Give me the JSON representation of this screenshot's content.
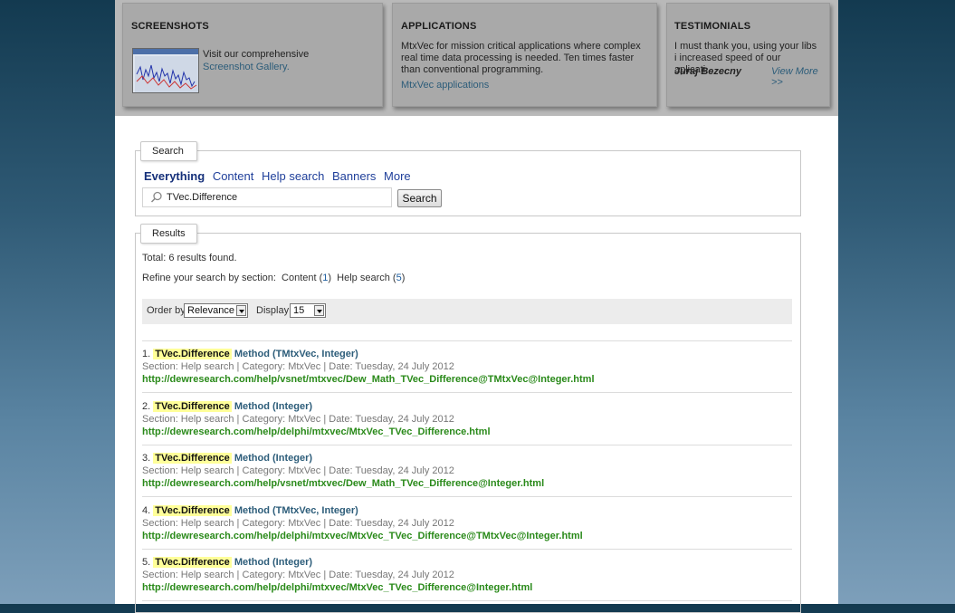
{
  "boxes": {
    "screenshots": {
      "title": "SCREENSHOTS",
      "text": "Visit our comprehensive",
      "link": "Screenshot Gallery."
    },
    "applications": {
      "title": "APPLICATIONS",
      "text": "MtxVec for mission critical applications where complex real time data processing is needed. Ten times faster than conventional programming.",
      "link": "MtxVec applications"
    },
    "testimonials": {
      "title": "TESTIMONIALS",
      "text": "I must thank you, using your libs i increased speed of our aplicati...",
      "author": "Juraj Bezecny",
      "more": "View More >>"
    }
  },
  "search": {
    "legend": "Search",
    "tabs": [
      "Everything",
      "Content",
      "Help search",
      "Banners",
      "More"
    ],
    "query": "TVec.Difference",
    "button": "Search"
  },
  "results": {
    "legend": "Results",
    "total": "Total: 6 results found.",
    "refine_label": "Refine your search by section:",
    "refine_content": "Content",
    "refine_content_count": "1",
    "refine_help": "Help search",
    "refine_help_count": "5",
    "order_label": "Order by",
    "order_value": "Relevance",
    "display_label": "Display",
    "display_value": "15",
    "items": [
      {
        "num": "1.",
        "highlight": "TVec.Difference",
        "method": "Method (TMtxVec, Integer)",
        "meta": "Section: Help search | Category: MtxVec | Date: Tuesday, 24 July 2012",
        "url": "http://dewresearch.com/help/vsnet/mtxvec/Dew_Math_TVec_Difference@TMtxVec@Integer.html"
      },
      {
        "num": "2.",
        "highlight": "TVec.Difference",
        "method": "Method (Integer)",
        "meta": "Section: Help search | Category: MtxVec | Date: Tuesday, 24 July 2012",
        "url": "http://dewresearch.com/help/delphi/mtxvec/MtxVec_TVec_Difference.html"
      },
      {
        "num": "3.",
        "highlight": "TVec.Difference",
        "method": "Method (Integer)",
        "meta": "Section: Help search | Category: MtxVec | Date: Tuesday, 24 July 2012",
        "url": "http://dewresearch.com/help/vsnet/mtxvec/Dew_Math_TVec_Difference@Integer.html"
      },
      {
        "num": "4.",
        "highlight": "TVec.Difference",
        "method": "Method (TMtxVec, Integer)",
        "meta": "Section: Help search | Category: MtxVec | Date: Tuesday, 24 July 2012",
        "url": "http://dewresearch.com/help/delphi/mtxvec/MtxVec_TVec_Difference@TMtxVec@Integer.html"
      },
      {
        "num": "5.",
        "highlight": "TVec.Difference",
        "method": "Method (Integer)",
        "meta": "Section: Help search | Category: MtxVec | Date: Tuesday, 24 July 2012",
        "url": "http://dewresearch.com/help/delphi/mtxvec/MtxVec_TVec_Difference@Integer.html"
      }
    ]
  },
  "colors": {
    "link": "#2d5d7a",
    "url": "#2a8a1a",
    "highlight": "#ffff99",
    "tab_active": "#15307a"
  },
  "icons": [
    "search-icon",
    "dropdown-arrow-icon"
  ]
}
